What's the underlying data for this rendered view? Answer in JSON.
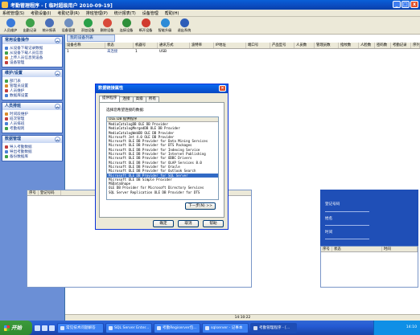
{
  "window": {
    "title": "考勤管理程序 - [ 临时超级用户 2010-09-19]",
    "controls": [
      "_",
      "□",
      "x"
    ]
  },
  "menu": [
    "系统管理(S)",
    "考勤设备(I)",
    "考勤记录(R)",
    "排班管理(P)",
    "统计报表(T)",
    "设备管理",
    "帮助(H)"
  ],
  "toolbar": [
    {
      "label": "人员维护",
      "color": "#3a7ad9"
    },
    {
      "label": "出勤记录",
      "color": "#3fa14a"
    },
    {
      "label": "统计报表",
      "color": "#4a6fb8"
    },
    {
      "label": "设备管理",
      "color": "#6f8fbf"
    },
    {
      "label": "添加设备",
      "color": "#2aa048"
    },
    {
      "label": "删除设备",
      "color": "#d84a3a"
    },
    {
      "label": "连接设备",
      "color": "#2f8f3a"
    },
    {
      "label": "断开设备",
      "color": "#d13b2f"
    },
    {
      "label": "智能升级",
      "color": "#2e8bd6"
    },
    {
      "label": "退出系统",
      "color": "#2e5db8"
    }
  ],
  "sidebar": {
    "sections": [
      {
        "title": "常用设备操作",
        "items": [
          "从设备下载记录数据",
          "从设备下载人员信息",
          "上传人员信息到设备",
          "设备管理"
        ]
      },
      {
        "title": "维护/设置",
        "items": [
          "部门表",
          "管理员设置",
          "人员维护",
          "数据库设置"
        ]
      },
      {
        "title": "人员排班",
        "items": [
          "时间段维护",
          "班次管理",
          "人员排班",
          "考勤规则"
        ]
      },
      {
        "title": "数据管理",
        "items": [
          "导入考勤数据",
          "导出考勤数据",
          "备份数据库"
        ]
      }
    ]
  },
  "main": {
    "tab_label": "我的设备列表",
    "grid_headers": [
      "设备名称",
      "状态",
      "机器号",
      "通讯方式",
      "波特率",
      "IP地址",
      "端口号",
      "产品型号",
      "人员数",
      "管理员数",
      "指纹数",
      "人脸数",
      "密码数",
      "考勤记录",
      "序列号"
    ],
    "rows": [
      [
        "1",
        "未连接",
        "1",
        "USB",
        "",
        "",
        "",
        "",
        "",
        "",
        "",
        "",
        "",
        "",
        ""
      ]
    ],
    "lower_headers": [
      "序号",
      "登记号码"
    ],
    "right_panel": {
      "labels": [
        "登记号码",
        "姓名",
        "时间"
      ],
      "table_headers": [
        "序号",
        "状态",
        "时间"
      ]
    },
    "status_time": "14:10:22"
  },
  "dialog": {
    "title": "数据链接属性",
    "tabs": [
      "提供程序",
      "连接",
      "高级",
      "所有"
    ],
    "prompt": "选择您希望连接的数据:",
    "list_header": "OLE DB 提供程序",
    "providers": [
      "MediaCatalogDB OLE DB Provider",
      "MediaCatalogMergedDB OLE DB Provider",
      "MediaCatalogWebDB OLE DB Provider",
      "Microsoft Jet 4.0 OLE DB Provider",
      "Microsoft OLE DB Provider for Data Mining Services",
      "Microsoft OLE DB Provider for DTS Packages",
      "Microsoft OLE DB Provider for Indexing Service",
      "Microsoft OLE DB Provider for Internet Publishing",
      "Microsoft OLE DB Provider for ODBC Drivers",
      "Microsoft OLE DB Provider for OLAP Services 8.0",
      "Microsoft OLE DB Provider for Oracle",
      "Microsoft OLE DB Provider for Outlook Search",
      "Microsoft OLE DB Provider for SQL Server",
      "Microsoft OLE DB Simple Provider",
      "MSDataShape",
      "OLE DB Provider for Microsoft Directory Services",
      "SQL Server Replication OLE DB Provider for DTS"
    ],
    "selected_index": 12,
    "next_label": "下一步(N) >>",
    "buttons": [
      "确定",
      "取消",
      "帮助"
    ]
  },
  "taskbar": {
    "start_label": "开始",
    "tasks": [
      "常见技术问题解答",
      "SQL Server Enter...",
      "考勤Regiserver包...",
      "sqlserver - 记事本",
      "考勤管理程序 - [..."
    ],
    "active_index": 4,
    "clock": "14:10"
  }
}
